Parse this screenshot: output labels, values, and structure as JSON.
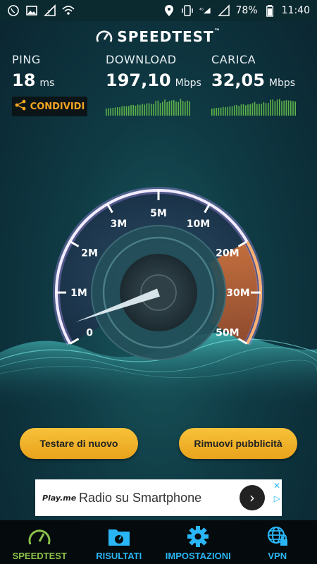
{
  "status_bar": {
    "battery": "78%",
    "time": "11:40",
    "network": "4G"
  },
  "header": {
    "title": "SPEEDTEST"
  },
  "metrics": {
    "ping": {
      "label": "PING",
      "value": "18",
      "unit": "ms"
    },
    "download": {
      "label": "DOWNLOAD",
      "value": "197,10",
      "unit": "Mbps"
    },
    "upload": {
      "label": "CARICA",
      "value": "32,05",
      "unit": "Mbps"
    }
  },
  "share_label": "CONDIVIDI",
  "gauge": {
    "ticks": [
      "0",
      "1M",
      "2M",
      "3M",
      "5M",
      "10M",
      "20M",
      "30M",
      "50M"
    ],
    "highlight_from": "20M",
    "highlight_to": "50M"
  },
  "actions": {
    "retest": "Testare di nuovo",
    "remove_ads": "Rimuovi pubblicità"
  },
  "ad": {
    "brand": "Play.me",
    "title": "Radio su Smartphone"
  },
  "nav": [
    {
      "label": "SPEEDTEST",
      "icon": "speedometer-icon",
      "active": true
    },
    {
      "label": "RISULTATI",
      "icon": "results-folder-icon",
      "active": false
    },
    {
      "label": "IMPOSTAZIONI",
      "icon": "gear-icon",
      "active": false
    },
    {
      "label": "VPN",
      "icon": "globe-lock-icon",
      "active": false
    }
  ],
  "colors": {
    "accent_orange": "#f5a623",
    "accent_blue": "#29b6f6",
    "accent_green": "#8bc34a",
    "button_yellow": "#f0b429",
    "gauge_purple": "#8a5cf6"
  }
}
